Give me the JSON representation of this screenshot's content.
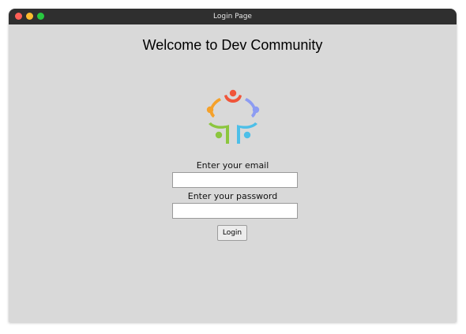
{
  "window": {
    "title": "Login Page",
    "controls": [
      "close",
      "minimize",
      "maximize"
    ]
  },
  "main": {
    "heading": "Welcome to Dev Community",
    "logo": "dev-community-logo",
    "email_label": "Enter your email",
    "email_value": "",
    "password_label": "Enter your password",
    "password_value": "",
    "login_button": "Login"
  },
  "colors": {
    "titlebar": "#2f2f2f",
    "background": "#d9d9d9",
    "logo_red": "#f0553a",
    "logo_orange": "#f5a12a",
    "logo_green": "#8cc63e",
    "logo_cyan": "#4dbfe8",
    "logo_blue": "#8d9cf2"
  }
}
